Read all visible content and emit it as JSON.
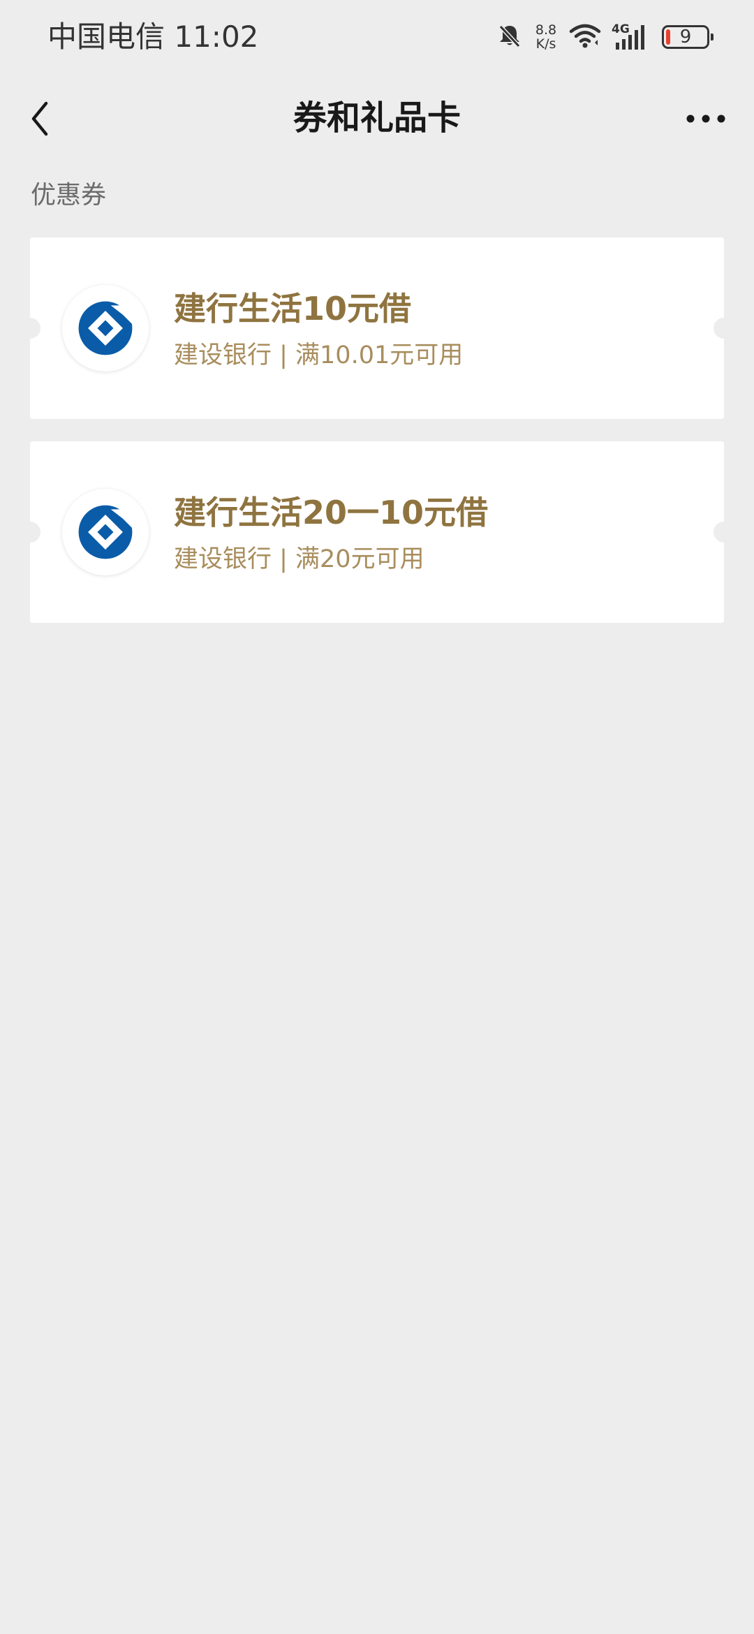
{
  "status_bar": {
    "carrier_time": "中国电信 11:02",
    "net_speed_value": "8.8",
    "net_speed_unit": "K/s",
    "network_type": "4G",
    "battery_level": "9",
    "battery_low_color": "#e8412f",
    "icons": [
      "bell-muted-icon",
      "wifi-icon",
      "cellular-signal-icon",
      "battery-icon"
    ]
  },
  "nav": {
    "title": "券和礼品卡",
    "back_icon": "chevron-left-icon",
    "more_icon": "more-dots-icon"
  },
  "section": {
    "label": "优惠券"
  },
  "coupons": [
    {
      "title": "建行生活10元借",
      "subtitle": "建设银行 | 满10.01元可用",
      "logo": "ccb-logo-icon"
    },
    {
      "title": "建行生活20一10元借",
      "subtitle": "建设银行 | 满20元可用",
      "logo": "ccb-logo-icon"
    }
  ],
  "colors": {
    "background": "#ededed",
    "card": "#ffffff",
    "coupon_title": "#8f7440",
    "coupon_subtitle": "#a88d5d",
    "brand_blue": "#0a5ca8"
  }
}
